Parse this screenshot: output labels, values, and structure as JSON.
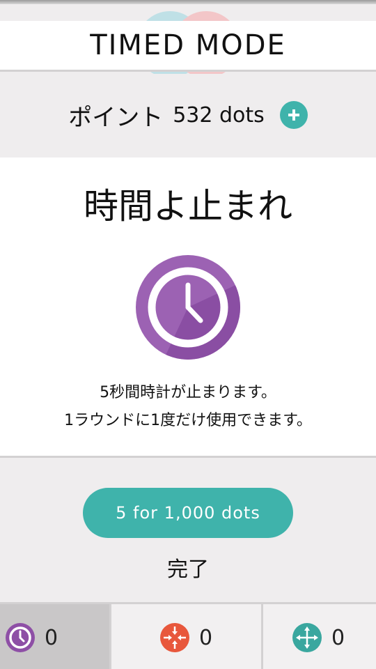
{
  "header": {
    "mode_title": "TIMED MODE"
  },
  "points": {
    "label": "ポイント",
    "value": "532 dots",
    "add_icon": "plus-icon"
  },
  "powerup": {
    "title": "時間よ止まれ",
    "icon": "clock-icon",
    "desc_line1": "5秒間時計が止まります。",
    "desc_line2": "1ラウンドに1度だけ使用できます。"
  },
  "actions": {
    "buy_label": "5 for 1,000 dots",
    "done_label": "完了"
  },
  "bottom_bar": {
    "items": [
      {
        "icon": "clock-icon",
        "count": "0",
        "color": "#8e4fa6"
      },
      {
        "icon": "shrink-arrows-icon",
        "count": "0",
        "color": "#e8573c"
      },
      {
        "icon": "expand-arrows-icon",
        "count": "0",
        "color": "#3aa79f"
      }
    ]
  },
  "colors": {
    "accent": "#3fb3ab",
    "clock": "#8e4fa6",
    "background": "#efedee"
  }
}
